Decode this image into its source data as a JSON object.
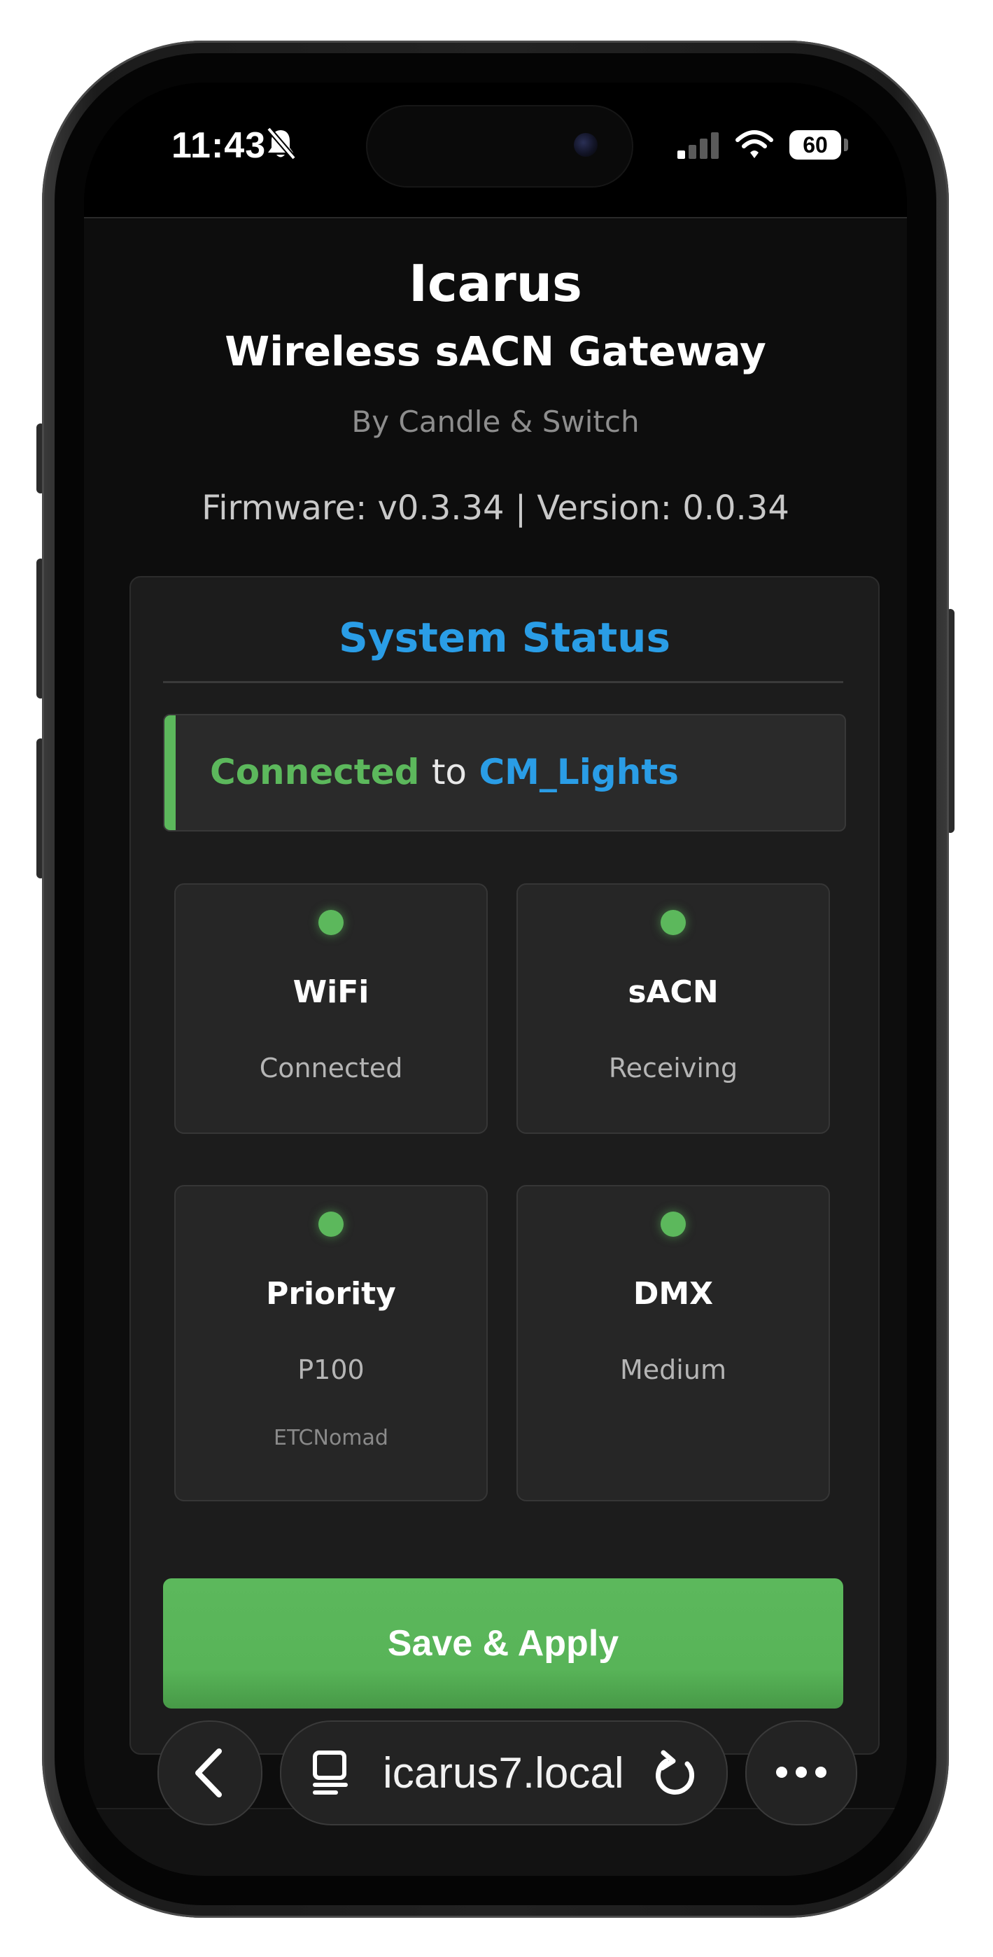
{
  "status_bar": {
    "time": "11:43",
    "battery": "60",
    "icons": [
      "bell-slash-icon",
      "cellular-signal-icon",
      "wifi-icon",
      "battery-icon"
    ]
  },
  "header": {
    "title": "Icarus",
    "subtitle": "Wireless sACN Gateway",
    "byline": "By Candle & Switch",
    "firmware": "Firmware: v0.3.34 | Version: 0.0.34"
  },
  "status_panel": {
    "title": "System Status",
    "connection": {
      "state": "Connected",
      "joiner": "to",
      "network": "CM_Lights"
    },
    "cards": [
      {
        "title": "WiFi",
        "value": "Connected",
        "extra": ""
      },
      {
        "title": "sACN",
        "value": "Receiving",
        "extra": ""
      },
      {
        "title": "Priority",
        "value": "P100",
        "extra": "ETCNomad"
      },
      {
        "title": "DMX",
        "value": "Medium",
        "extra": ""
      }
    ],
    "indicator_color": "#5cb85c",
    "save_label": "Save & Apply"
  },
  "browser": {
    "url": "icarus7.local",
    "icons": [
      "back-icon",
      "page-icon",
      "reload-icon",
      "more-icon"
    ]
  },
  "colors": {
    "accent_blue": "#2a9de6",
    "accent_green": "#5cb85c",
    "background": "#0d0d0d",
    "panel": "#1c1c1c"
  }
}
